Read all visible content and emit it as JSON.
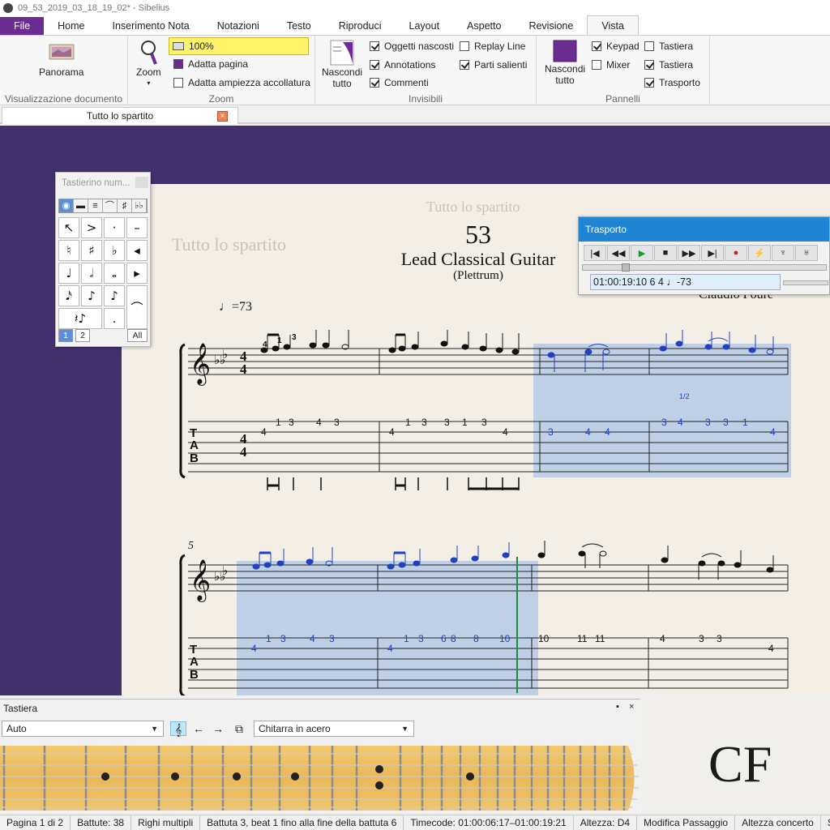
{
  "window": {
    "title": "09_53_2019_03_18_19_02* - Sibelius"
  },
  "ribbon_tabs": [
    "File",
    "Home",
    "Inserimento Nota",
    "Notazioni",
    "Testo",
    "Riproduci",
    "Layout",
    "Aspetto",
    "Revisione",
    "Vista"
  ],
  "active_tab": "Vista",
  "ribbon": {
    "view_group": {
      "panorama": "Panorama",
      "label": "Visualizzazione documento"
    },
    "zoom_group": {
      "zoom": "Zoom",
      "zoom_value": "100%",
      "fit_page": "Adatta pagina",
      "fit_width": "Adatta ampiezza accollatura",
      "label": "Zoom"
    },
    "invisibles_group": {
      "hide_all_1": "Nascondi",
      "hide_all_2": "tutto",
      "hidden_objects": "Oggetti nascosti",
      "annotations": "Annotations",
      "comments": "Commenti",
      "replay_line": "Replay Line",
      "highlights": "Parti salienti",
      "label": "Invisibili"
    },
    "panels_group": {
      "hide_all_1": "Nascondi",
      "hide_all_2": "tutto",
      "keypad": "Keypad",
      "mixer": "Mixer",
      "keyboard": "Tastiera",
      "fretboard": "Tastiera",
      "transport": "Trasporto",
      "label": "Pannelli"
    }
  },
  "checkboxes": {
    "hidden_objects": true,
    "annotations": true,
    "comments": true,
    "replay_line": false,
    "highlights": true,
    "keypad": true,
    "mixer": false,
    "keyboard": false,
    "fretboard": true,
    "transport": true
  },
  "document_tab": {
    "label": "Tutto lo spartito",
    "close": "×"
  },
  "score": {
    "watermark_top": "Tutto lo spartito",
    "watermark_left": "Tutto lo spartito",
    "number": "53",
    "title": "Lead Classical Guitar",
    "subtitle": "(Plettrum)",
    "composer": "Claudio Foure",
    "tempo": "♩=73",
    "bar_number_2": "5",
    "tab_letters": [
      "T",
      "A",
      "B"
    ],
    "system1": {
      "fingerings": [
        "4",
        "1",
        "3"
      ],
      "tab_bar1": [
        "4",
        "1",
        "3",
        "4",
        "3"
      ],
      "tab_bar2": [
        "4",
        "1",
        "3",
        "3",
        "1",
        "3",
        "4"
      ],
      "tab_bar3": [
        "3",
        "4",
        "4"
      ],
      "tab_bar4": [
        "3",
        "4",
        "3",
        "3",
        "1",
        "4"
      ],
      "bend_label": "1/2"
    },
    "system2": {
      "tab_bar5": [
        "4",
        "1",
        "3",
        "4",
        "3"
      ],
      "tab_bar6": [
        "4",
        "1",
        "3",
        "6",
        "8",
        "8",
        "10"
      ],
      "tab_bar7": [
        "10",
        "11",
        "11"
      ],
      "tab_bar8": [
        "4",
        "3",
        "3",
        "4"
      ]
    }
  },
  "keypad": {
    "title": "Tastierino num...",
    "top_row": [
      "◉",
      "▬",
      "≡",
      "⌒",
      "♯",
      "♭♭"
    ],
    "keys": [
      "↖",
      ">",
      "·",
      "–",
      "♮",
      "♯",
      "♭",
      "◂",
      "♩",
      "𝅗𝅥",
      "𝅝",
      "▸",
      "𝅘𝅥𝅯",
      "♪",
      "♪",
      "",
      "𝄽♪",
      "",
      ".",
      "⌒"
    ],
    "layers": [
      "1",
      "2"
    ],
    "all": "All"
  },
  "transport": {
    "title": "Trasporto",
    "buttons": [
      "|◀",
      "◀◀",
      "▶",
      "■",
      "▶▶",
      "▶|",
      "●",
      "⚡",
      "♆",
      "♅"
    ],
    "timecode": "01:00:19:10 6    4   ♩-73"
  },
  "fretboard_panel": {
    "title": "Tastiera",
    "mode": "Auto",
    "instrument": "Chitarra in acero",
    "pin": "▪",
    "close": "×"
  },
  "logo": {
    "text": "CF"
  },
  "status_bar": [
    "Pagina 1 di 2",
    "Battute: 38",
    "Righi multipli",
    "Battuta 3, beat 1 fino alla fine della battuta 6",
    "Timecode: 01:00:06:17–01:00:19:21",
    "Altezza: D4",
    "Modifica Passaggio",
    "Altezza concerto",
    "S"
  ],
  "colors": {
    "ribbon_accent": "#6a2c91",
    "workspace_bg": "#42306c",
    "selection": "#8cafe6",
    "transport_title": "#1f86d6",
    "selected_notes": "#2040c0"
  }
}
